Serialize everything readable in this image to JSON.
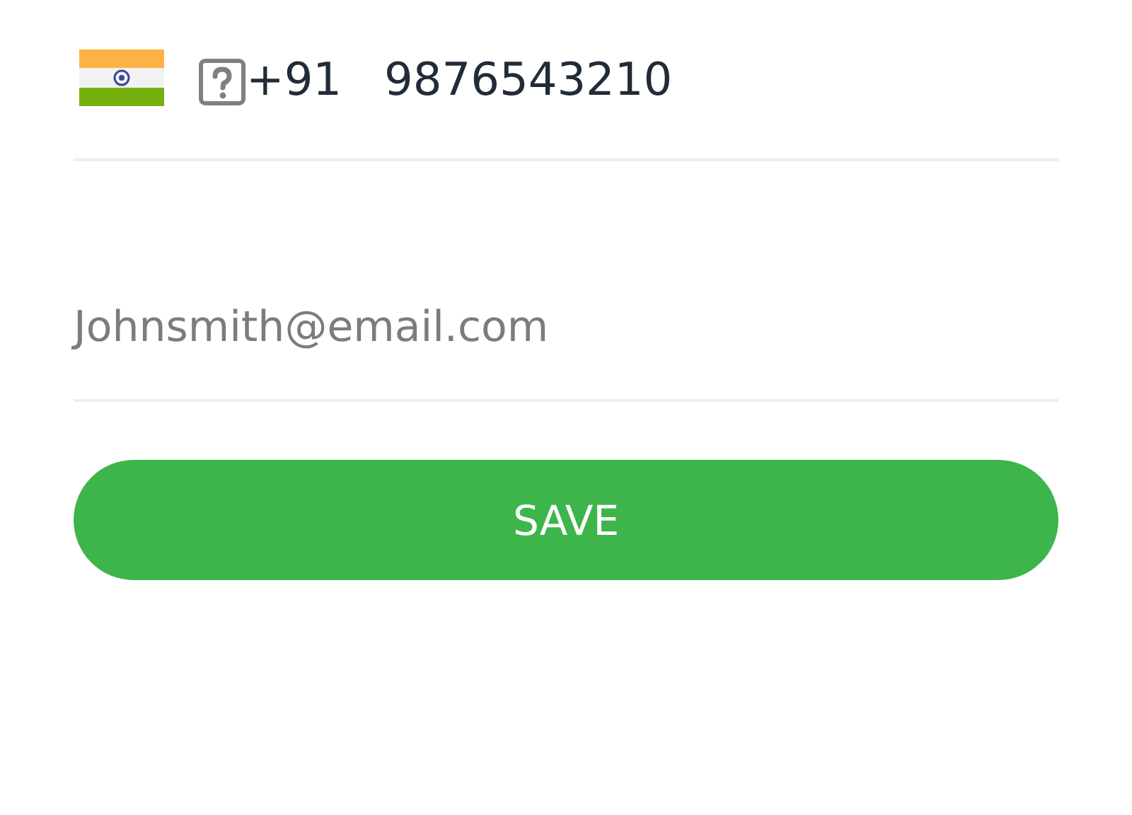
{
  "phone": {
    "dial_code": "+91",
    "value": "9876543210"
  },
  "email": {
    "placeholder": "Johnsmith@email.com"
  },
  "button": {
    "label": "SAVE"
  }
}
